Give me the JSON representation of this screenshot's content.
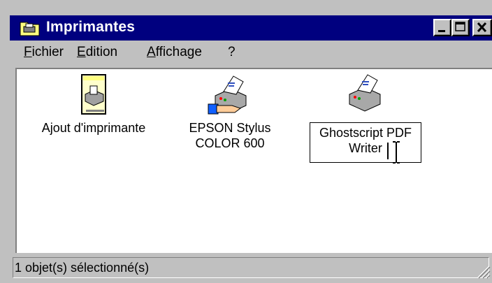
{
  "window": {
    "title": "Imprimantes",
    "title_icon": "printers-folder-icon",
    "controls": [
      "minimize-icon",
      "maximize-icon",
      "close-icon"
    ]
  },
  "menu": {
    "items": [
      {
        "label": "Fichier"
      },
      {
        "label": "Edition"
      },
      {
        "label": "Affichage"
      },
      {
        "label": "?"
      }
    ]
  },
  "printers": [
    {
      "label": "Ajout d'imprimante",
      "icon": "add-printer-icon"
    },
    {
      "label": "EPSON Stylus\nCOLOR 600",
      "icon": "shared-printer-icon"
    },
    {
      "label": "Ghostscript PDF\nWriter",
      "icon": "printer-icon",
      "state": "renaming"
    }
  ],
  "status": {
    "text": "1 objet(s) sélectionné(s)"
  },
  "colors": {
    "titlebar": "#00007f",
    "face": "#c0c0c0"
  }
}
